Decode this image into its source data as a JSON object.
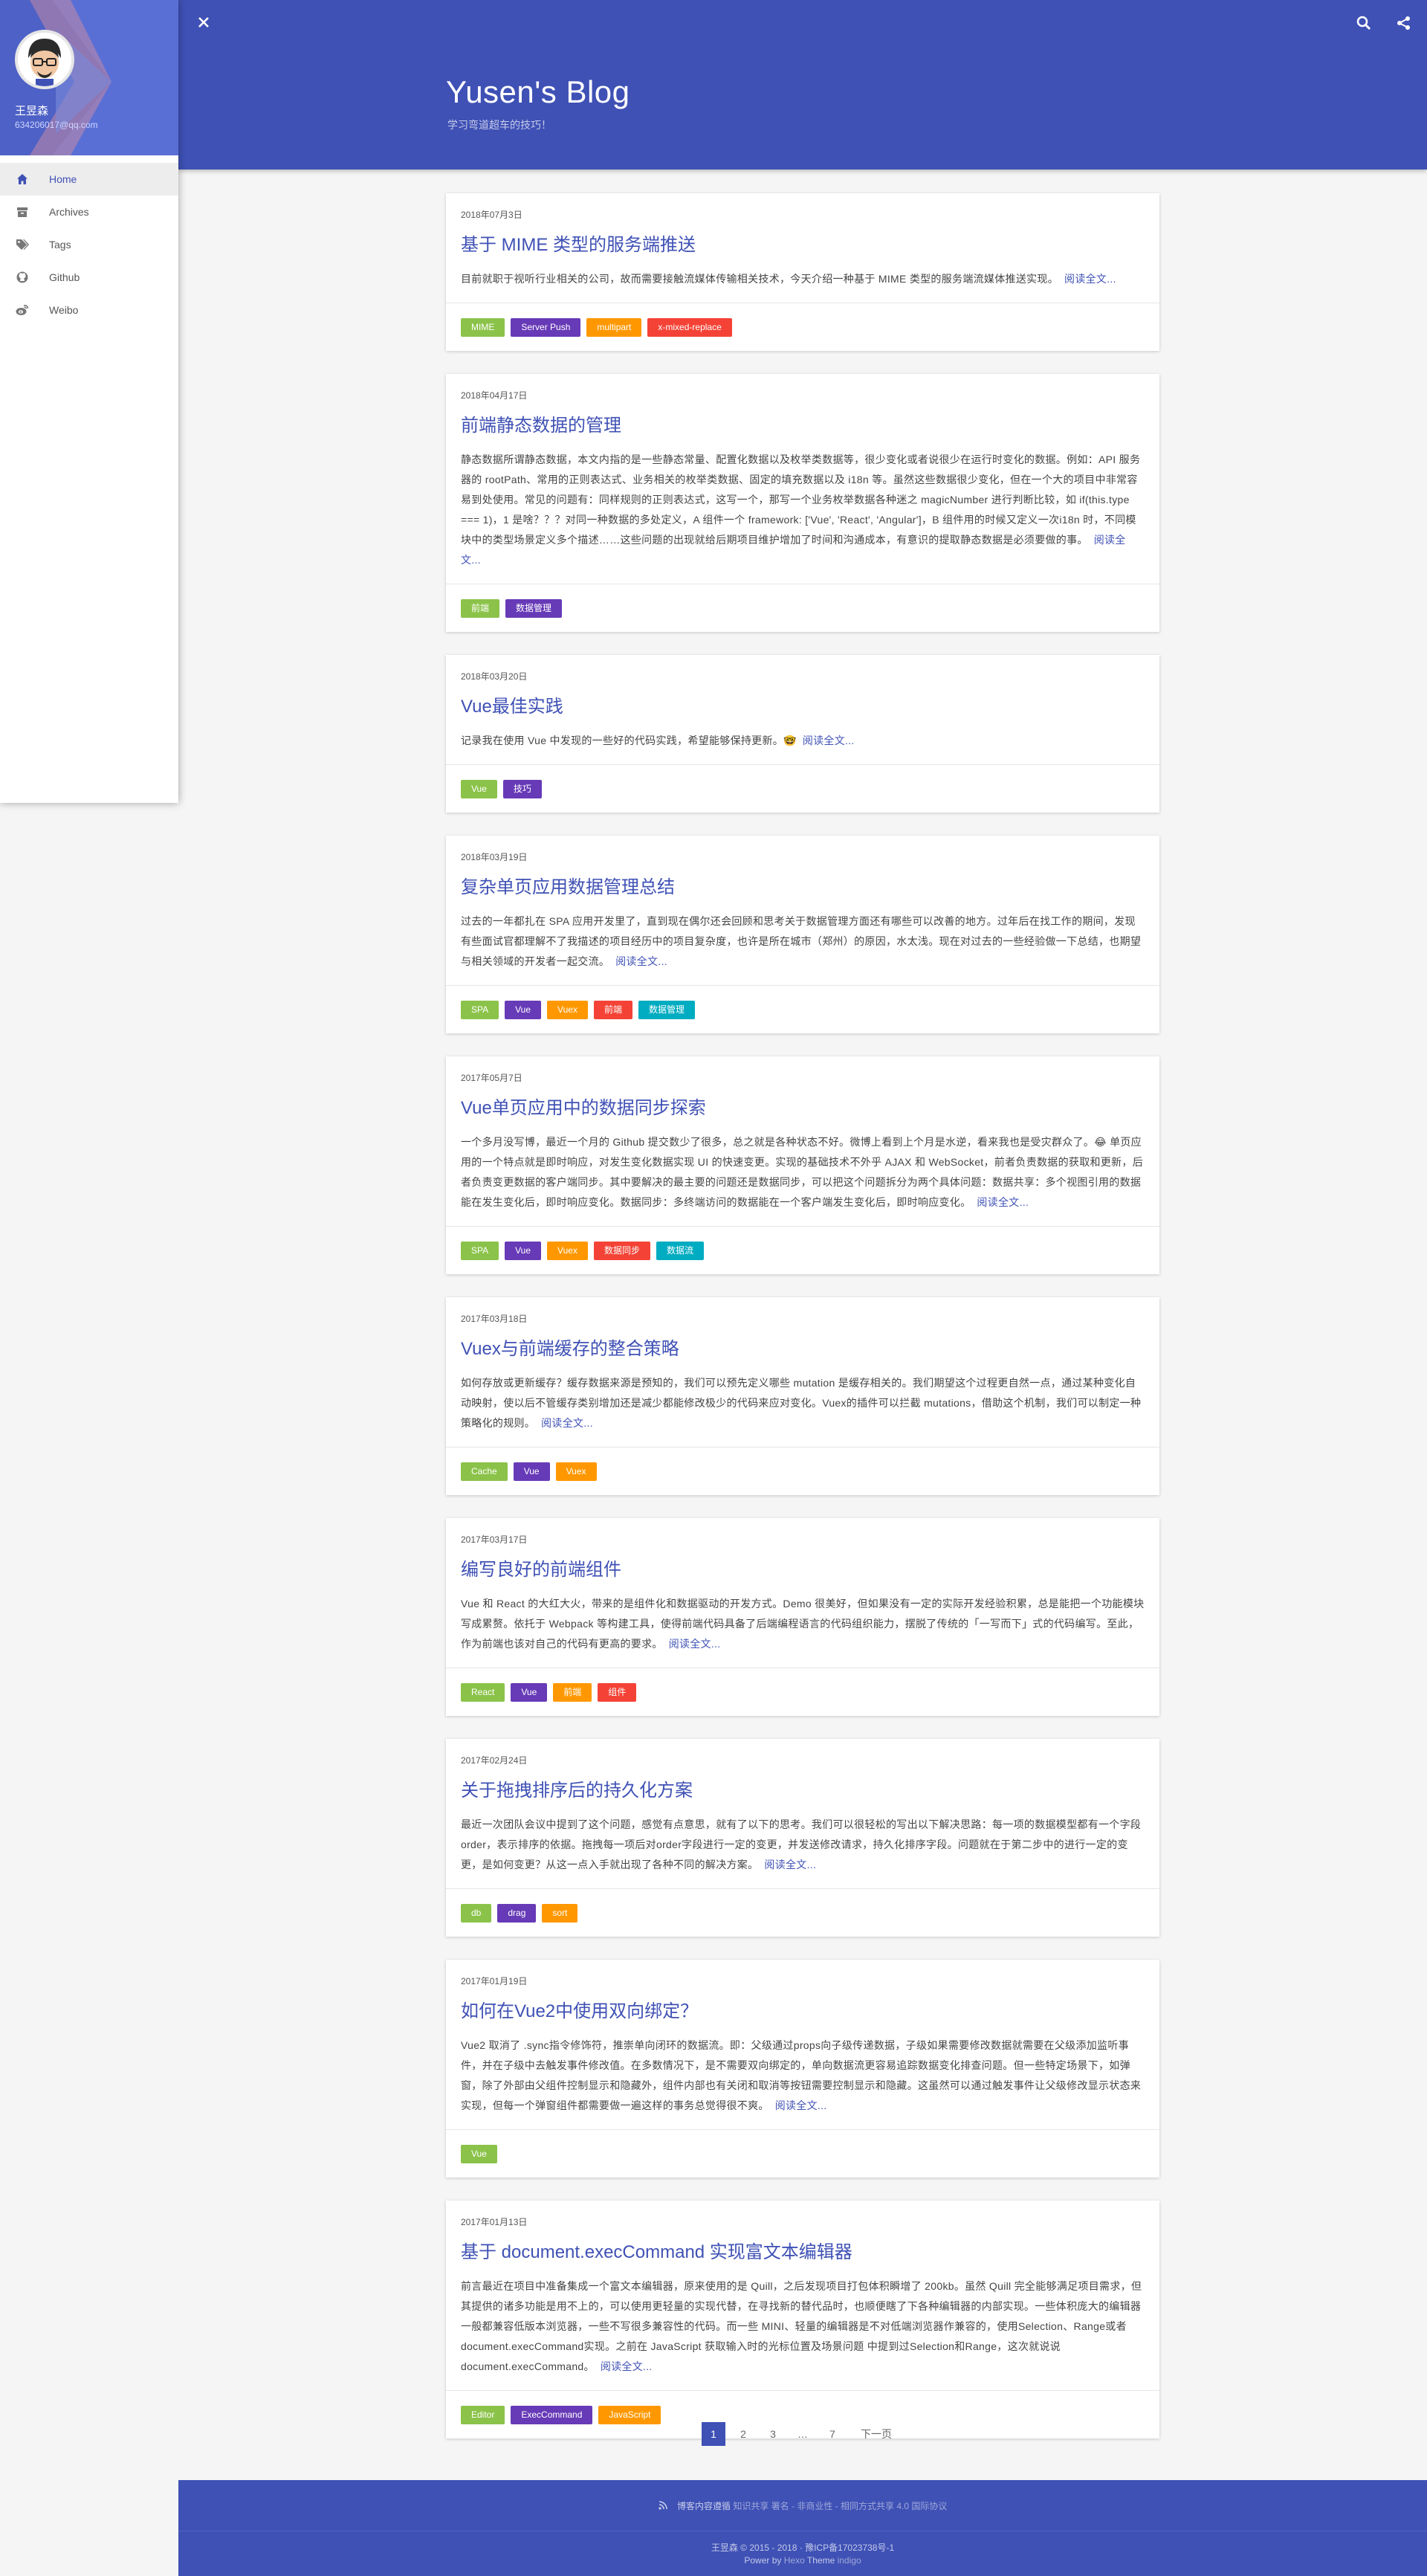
{
  "header": {
    "title": "Yusen's Blog",
    "subtitle": "学习弯道超车的技巧！"
  },
  "sidebar": {
    "name": "王昱森",
    "email": "634206017@qq.com",
    "items": [
      {
        "label": "Home",
        "icon": "home-icon",
        "active": true
      },
      {
        "label": "Archives",
        "icon": "archive-icon",
        "active": false
      },
      {
        "label": "Tags",
        "icon": "tags-icon",
        "active": false
      },
      {
        "label": "Github",
        "icon": "github-icon",
        "active": false
      },
      {
        "label": "Weibo",
        "icon": "weibo-icon",
        "active": false
      }
    ]
  },
  "read_more": "阅读全文...",
  "tag_colors": {
    "green": "#8bc34a",
    "purple": "#673ab7",
    "orange": "#ff9800",
    "red": "#f44336",
    "cyan": "#00acc1"
  },
  "posts": [
    {
      "date": "2018年07月3日",
      "title": "基于 MIME 类型的服务端推送",
      "excerpt": "目前就职于视听行业相关的公司，故而需要接触流媒体传输相关技术，今天介绍一种基于 MIME 类型的服务端流媒体推送实现。",
      "tags": [
        {
          "name": "MIME",
          "color": "green"
        },
        {
          "name": "Server Push",
          "color": "purple"
        },
        {
          "name": "multipart",
          "color": "orange"
        },
        {
          "name": "x-mixed-replace",
          "color": "red"
        }
      ]
    },
    {
      "date": "2018年04月17日",
      "title": "前端静态数据的管理",
      "excerpt": "静态数据所谓静态数据，本文内指的是一些静态常量、配置化数据以及枚举类数据等，很少变化或者说很少在运行时变化的数据。例如：API 服务器的 rootPath、常用的正则表达式、业务相关的枚举类数据、固定的填充数据以及 i18n 等。虽然这些数据很少变化，但在一个大的项目中非常容易到处使用。常见的问题有：同样规则的正则表达式，这写一个，那写一个业务枚举数据各种迷之 magicNumber 进行判断比较，如 if(this.type === 1)，1 是啥？？？对同一种数据的多处定义，A 组件一个 framework: ['Vue', 'React', 'Angular']，B 组件用的时候又定义一次i18n 时，不同模块中的类型场景定义多个描述……这些问题的出现就给后期项目维护增加了时间和沟通成本，有意识的提取静态数据是必须要做的事。",
      "tags": [
        {
          "name": "前端",
          "color": "green"
        },
        {
          "name": "数据管理",
          "color": "purple"
        }
      ]
    },
    {
      "date": "2018年03月20日",
      "title": "Vue最佳实践",
      "excerpt": "记录我在使用 Vue 中发现的一些好的代码实践，希望能够保持更新。🤓",
      "tags": [
        {
          "name": "Vue",
          "color": "green"
        },
        {
          "name": "技巧",
          "color": "purple"
        }
      ]
    },
    {
      "date": "2018年03月19日",
      "title": "复杂单页应用数据管理总结",
      "excerpt": "过去的一年都扎在 SPA 应用开发里了，直到现在偶尔还会回顾和思考关于数据管理方面还有哪些可以改善的地方。过年后在找工作的期间，发现有些面试官都理解不了我描述的项目经历中的项目复杂度，也许是所在城市（郑州）的原因，水太浅。现在对过去的一些经验做一下总结，也期望与相关领域的开发者一起交流。",
      "tags": [
        {
          "name": "SPA",
          "color": "green"
        },
        {
          "name": "Vue",
          "color": "purple"
        },
        {
          "name": "Vuex",
          "color": "orange"
        },
        {
          "name": "前端",
          "color": "red"
        },
        {
          "name": "数据管理",
          "color": "cyan"
        }
      ]
    },
    {
      "date": "2017年05月7日",
      "title": "Vue单页应用中的数据同步探索",
      "excerpt": "一个多月没写博，最近一个月的 Github 提交数少了很多，总之就是各种状态不好。微博上看到上个月是水逆，看来我也是受灾群众了。😂 单页应用的一个特点就是即时响应，对发生变化数据实现 UI 的快速变更。实现的基础技术不外乎 AJAX 和 WebSocket，前者负责数据的获取和更新，后者负责变更数据的客户端同步。其中要解决的最主要的问题还是数据同步，可以把这个问题拆分为两个具体问题：数据共享：多个视图引用的数据能在发生变化后，即时响应变化。数据同步：多终端访问的数据能在一个客户端发生变化后，即时响应变化。",
      "tags": [
        {
          "name": "SPA",
          "color": "green"
        },
        {
          "name": "Vue",
          "color": "purple"
        },
        {
          "name": "Vuex",
          "color": "orange"
        },
        {
          "name": "数据同步",
          "color": "red"
        },
        {
          "name": "数据流",
          "color": "cyan"
        }
      ]
    },
    {
      "date": "2017年03月18日",
      "title": "Vuex与前端缓存的整合策略",
      "excerpt": "如何存放或更新缓存？缓存数据来源是预知的，我们可以预先定义哪些 mutation 是缓存相关的。我们期望这个过程更自然一点，通过某种变化自动映射，使以后不管缓存类别增加还是减少都能修改极少的代码来应对变化。Vuex的插件可以拦截 mutations，借助这个机制，我们可以制定一种策略化的规则。",
      "tags": [
        {
          "name": "Cache",
          "color": "green"
        },
        {
          "name": "Vue",
          "color": "purple"
        },
        {
          "name": "Vuex",
          "color": "orange"
        }
      ]
    },
    {
      "date": "2017年03月17日",
      "title": "编写良好的前端组件",
      "excerpt": "Vue 和 React 的大红大火，带来的是组件化和数据驱动的开发方式。Demo 很美好，但如果没有一定的实际开发经验积累，总是能把一个功能模块写成累赘。依托于 Webpack 等构建工具，使得前端代码具备了后端编程语言的代码组织能力，摆脱了传统的「一写而下」式的代码编写。至此，作为前端也该对自己的代码有更高的要求。",
      "tags": [
        {
          "name": "React",
          "color": "green"
        },
        {
          "name": "Vue",
          "color": "purple"
        },
        {
          "name": "前端",
          "color": "orange"
        },
        {
          "name": "组件",
          "color": "red"
        }
      ]
    },
    {
      "date": "2017年02月24日",
      "title": "关于拖拽排序后的持久化方案",
      "excerpt": "最近一次团队会议中提到了这个问题，感觉有点意思，就有了以下的思考。我们可以很轻松的写出以下解决思路：每一项的数据模型都有一个字段order，表示排序的依据。拖拽每一项后对order字段进行一定的变更，并发送修改请求，持久化排序字段。问题就在于第二步中的进行一定的变更，是如何变更？从这一点入手就出现了各种不同的解决方案。",
      "tags": [
        {
          "name": "db",
          "color": "green"
        },
        {
          "name": "drag",
          "color": "purple"
        },
        {
          "name": "sort",
          "color": "orange"
        }
      ]
    },
    {
      "date": "2017年01月19日",
      "title": "如何在Vue2中使用双向绑定？",
      "excerpt": "Vue2 取消了 .sync指令修饰符，推崇单向闭环的数据流。即：父级通过props向子级传递数据，子级如果需要修改数据就需要在父级添加监听事件，并在子级中去触发事件修改值。在多数情况下，是不需要双向绑定的，单向数据流更容易追踪数据变化排查问题。但一些特定场景下，如弹窗，除了外部由父组件控制显示和隐藏外，组件内部也有关闭和取消等按钮需要控制显示和隐藏。这虽然可以通过触发事件让父级修改显示状态来实现，但每一个弹窗组件都需要做一遍这样的事务总觉得很不爽。",
      "tags": [
        {
          "name": "Vue",
          "color": "green"
        }
      ]
    },
    {
      "date": "2017年01月13日",
      "title": "基于 document.execCommand 实现富文本编辑器",
      "excerpt": "前言最近在项目中准备集成一个富文本编辑器，原来使用的是 Quill，之后发现项目打包体积瞬增了 200kb。虽然 Quill 完全能够满足项目需求，但其提供的诸多功能是用不上的，可以使用更轻量的实现代替，在寻找新的替代品时，也顺便瞎了下各种编辑器的内部实现。一些体积庞大的编辑器一般都兼容低版本浏览器，一些不写很多兼容性的代码。而一些 MINI、轻量的编辑器是不对低端浏览器作兼容的，使用Selection、Range或者document.execCommand实现。之前在 JavaScript 获取输入时的光标位置及场景问题 中提到过Selection和Range，这次就说说document.execCommand。",
      "tags": [
        {
          "name": "Editor",
          "color": "green"
        },
        {
          "name": "ExecCommand",
          "color": "purple"
        },
        {
          "name": "JavaScript",
          "color": "orange"
        }
      ]
    }
  ],
  "pagination": {
    "pages": [
      "1",
      "2",
      "3",
      "…",
      "7"
    ],
    "next": "下一页"
  },
  "footer": {
    "license_prefix": "博客内容遵循",
    "license_link": "知识共享 署名 - 非商业性 - 相同方式共享 4.0 国际协议",
    "copyright": "王昱森 © 2015 - 2018 · 豫ICP备17023738号-1",
    "powered_prefix": "Power by",
    "hexo": "Hexo",
    "theme_prefix": "Theme",
    "theme": "indigo"
  }
}
